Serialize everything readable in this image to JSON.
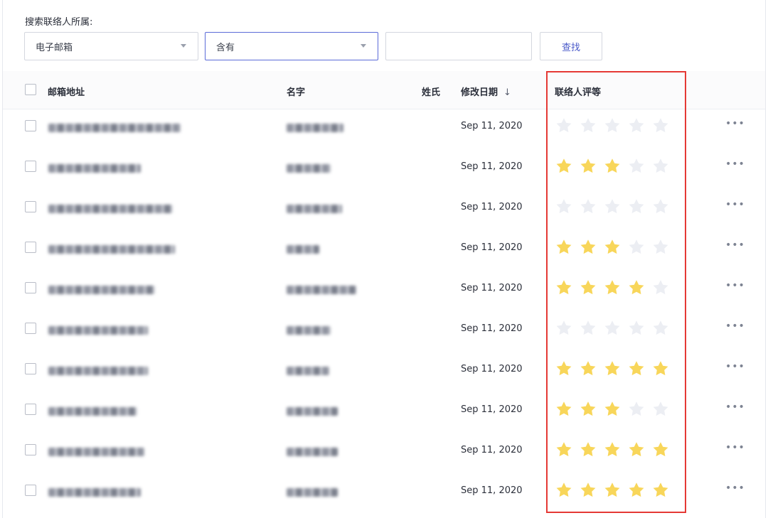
{
  "search": {
    "label": "搜索联络人所属:",
    "field_select": "电子邮箱",
    "operator_select": "含有",
    "value_input": "",
    "find_button": "查找"
  },
  "table": {
    "headers": {
      "email": "邮箱地址",
      "first_name": "名字",
      "last_name": "姓氏",
      "modified_date": "修改日期",
      "rating": "联络人评等"
    },
    "sort_indicator": "↓",
    "more_label": "•••",
    "rows": [
      {
        "date": "Sep 11, 2020",
        "rating": 0
      },
      {
        "date": "Sep 11, 2020",
        "rating": 3
      },
      {
        "date": "Sep 11, 2020",
        "rating": 0
      },
      {
        "date": "Sep 11, 2020",
        "rating": 3
      },
      {
        "date": "Sep 11, 2020",
        "rating": 4
      },
      {
        "date": "Sep 11, 2020",
        "rating": 0
      },
      {
        "date": "Sep 11, 2020",
        "rating": 5
      },
      {
        "date": "Sep 11, 2020",
        "rating": 3
      },
      {
        "date": "Sep 11, 2020",
        "rating": 5
      },
      {
        "date": "Sep 11, 2020",
        "rating": 5
      }
    ],
    "max_rating": 5
  },
  "colors": {
    "star_filled": "#f8d65a",
    "star_empty": "#eceef3",
    "highlight_border": "#e53935",
    "accent": "#4a5ac9"
  }
}
